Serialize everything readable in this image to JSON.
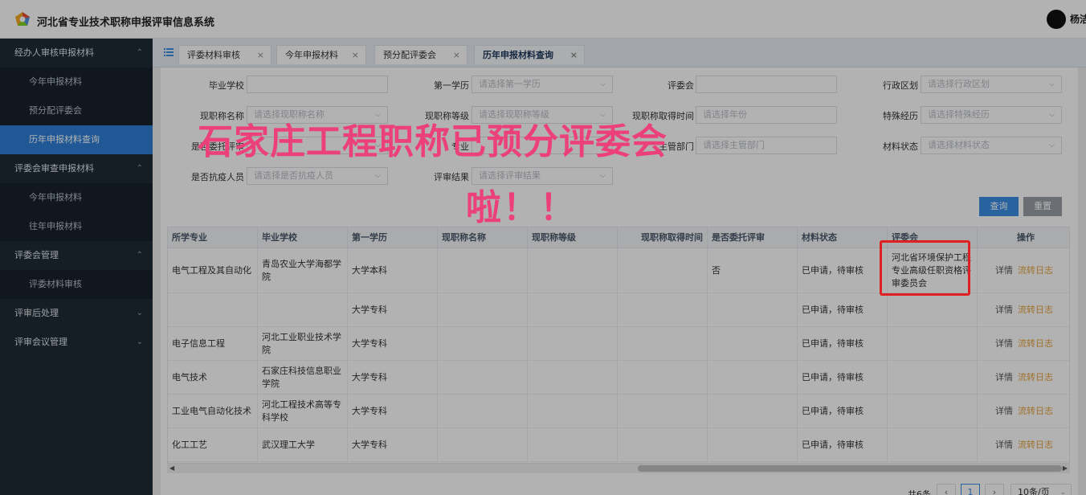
{
  "header": {
    "title": "河北省专业技术职称申报评审信息系统",
    "user": "杨洁"
  },
  "sidebar": {
    "groups": [
      {
        "label": "经办人审核申报材料",
        "items": [
          "今年申报材料",
          "预分配评委会",
          "历年申报材料查询"
        ]
      },
      {
        "label": "评委会审查申报材料",
        "items": [
          "今年申报材料",
          "往年申报材料"
        ]
      },
      {
        "label": "评委会管理",
        "items": [
          "评委材料审核"
        ]
      },
      {
        "label": "评审后处理",
        "items": []
      },
      {
        "label": "评审会议管理",
        "items": []
      }
    ],
    "active": "历年申报材料查询"
  },
  "tabs": [
    {
      "label": "评委材料审核"
    },
    {
      "label": "今年申报材料"
    },
    {
      "label": "预分配评委会"
    },
    {
      "label": "历年申报材料查询"
    }
  ],
  "filters": [
    {
      "label": "毕业学校",
      "placeholder": ""
    },
    {
      "label": "第一学历",
      "placeholder": "请选择第一学历"
    },
    {
      "label": "评委会",
      "placeholder": ""
    },
    {
      "label": "行政区划",
      "placeholder": "请选择行政区划"
    },
    {
      "label": "现职称名称",
      "placeholder": "请选择现职称名称"
    },
    {
      "label": "现职称等级",
      "placeholder": "请选择现职称等级"
    },
    {
      "label": "现职称取得时间",
      "placeholder": "请选择年份"
    },
    {
      "label": "特殊经历",
      "placeholder": "请选择特殊经历"
    },
    {
      "label": "是否委托评审",
      "placeholder": ""
    },
    {
      "label": "专业",
      "placeholder": ""
    },
    {
      "label": "主管部门",
      "placeholder": "请选择主管部门"
    },
    {
      "label": "材料状态",
      "placeholder": "请选择材料状态"
    },
    {
      "label": "是否抗疫人员",
      "placeholder": "请选择是否抗疫人员"
    },
    {
      "label": "评审结果",
      "placeholder": "请选择评审结果"
    }
  ],
  "buttons": {
    "query": "查询",
    "reset": "重置"
  },
  "table": {
    "columns": [
      "所学专业",
      "毕业学校",
      "第一学历",
      "现职称名称",
      "现职称等级",
      "现职称取得时间",
      "是否委托评审",
      "材料状态",
      "评委会",
      "操作"
    ],
    "rows": [
      [
        "电气工程及其自动化",
        "青岛农业大学海都学院",
        "大学本科",
        "",
        "",
        "",
        "否",
        "已申请，待审核",
        "河北省环境保护工程专业高级任职资格评审委员会"
      ],
      [
        "",
        "",
        "大学专科",
        "",
        "",
        "",
        "",
        "已申请，待审核",
        ""
      ],
      [
        "电子信息工程",
        "河北工业职业技术学院",
        "大学专科",
        "",
        "",
        "",
        "",
        "已申请，待审核",
        ""
      ],
      [
        "电气技术",
        "石家庄科技信息职业学院",
        "大学专科",
        "",
        "",
        "",
        "",
        "已申请，待审核",
        ""
      ],
      [
        "工业电气自动化技术",
        "河北工程技术高等专科学校",
        "大学专科",
        "",
        "",
        "",
        "",
        "已申请，待审核",
        ""
      ],
      [
        "化工工艺",
        "武汉理工大学",
        "大学专科",
        "",
        "",
        "",
        "",
        "已申请，待审核",
        ""
      ]
    ],
    "actions": {
      "detail": "详情",
      "log": "流转日志"
    }
  },
  "pagination": {
    "total": "共6条",
    "page": "1",
    "size": "10条/页"
  },
  "overlay": {
    "line1": "石家庄工程职称已预分评委会",
    "line2": "啦！！"
  },
  "colors": {
    "sidebar": "#1f2a36",
    "active": "#2d7ed6",
    "overlay_text": "#ec407a",
    "highlight": "#e02020"
  }
}
